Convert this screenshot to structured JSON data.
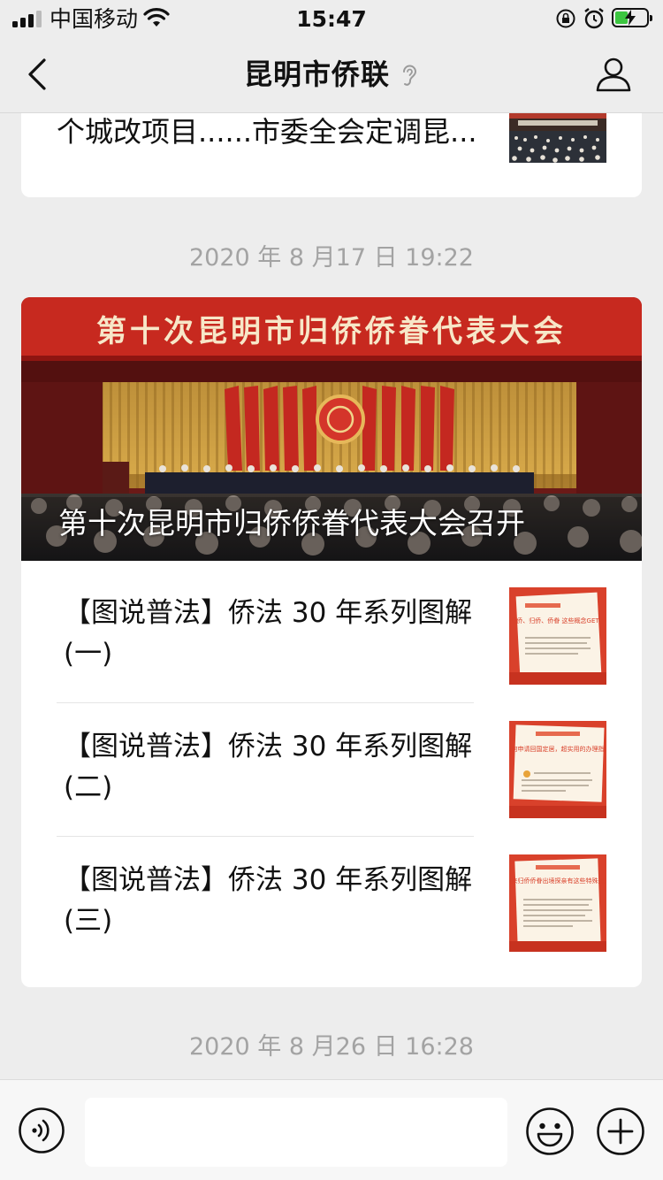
{
  "status_bar": {
    "carrier": "中国移动",
    "time": "15:47",
    "battery_color": "#3cc640"
  },
  "nav": {
    "title": "昆明市侨联",
    "back_icon": "chevron-left-icon",
    "ear_icon": "ear-icon",
    "profile_icon": "person-icon"
  },
  "messages": {
    "top_card_text": "个城改项目......市委全会定调昆...",
    "timestamp_1": "2020 年 8 月17 日 19:22",
    "hero_banner_text": "第十次昆明市归侨侨眷代表大会",
    "hero_title": "第十次昆明市归侨侨眷代表大会召开",
    "items": [
      {
        "title": "【图说普法】侨法 30 年系列图解(一)",
        "thumb_heading": "华侨、归侨、侨眷 这些概念GET下",
        "thumb_tag": "侨法30年系列图解"
      },
      {
        "title": "【图说普法】侨法 30 年系列图解(二)",
        "thumb_heading": "华侨如何申请回国定居，超实用的办理指南来了",
        "thumb_tag": "侨法30年系列图解"
      },
      {
        "title": "【图说普法】侨法 30 年系列图解(三)",
        "thumb_heading": "原来归侨侨眷出境探亲有这些特殊规定",
        "thumb_tag": "侨法30年系列图解"
      }
    ],
    "timestamp_2": "2020 年 8 月26 日 16:28"
  },
  "input_bar": {
    "input_value": "",
    "voice_icon": "voice-icon",
    "emoji_icon": "emoji-icon",
    "plus_icon": "plus-icon"
  },
  "colors": {
    "background": "#ededed",
    "timestamp": "#a3a3a3",
    "thumb_red": "#d9412b"
  }
}
